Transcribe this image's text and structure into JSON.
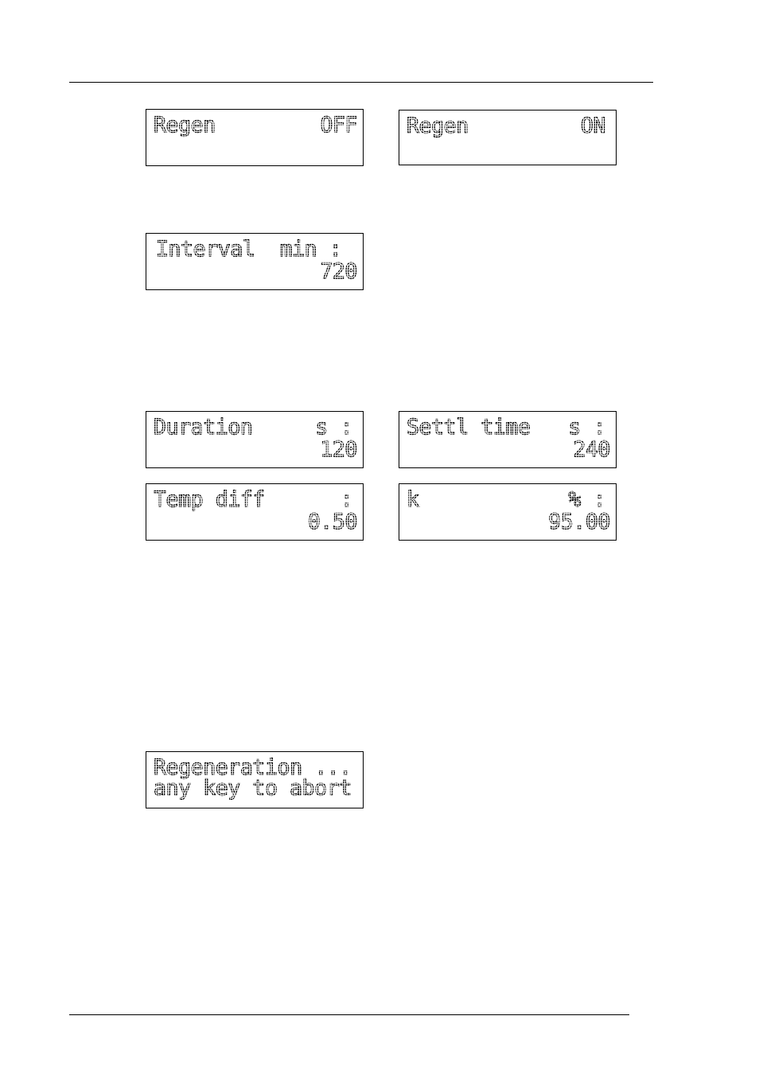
{
  "displays": [
    {
      "id": "regen-off",
      "line1_left": "Regen",
      "line1_right": "OFF",
      "line2_left": "",
      "line2_right": ""
    },
    {
      "id": "regen-on",
      "line1_left": "Regen",
      "line1_right": "ON",
      "line2_left": "",
      "line2_right": ""
    },
    {
      "id": "interval",
      "line1_left": "Interval  min :",
      "line1_right": "",
      "line2_left": "",
      "line2_right": "720"
    },
    {
      "id": "duration",
      "line1_left": "Duration",
      "line1_right": "s :",
      "line2_left": "",
      "line2_right": "120"
    },
    {
      "id": "settl-time",
      "line1_left": "Settl time",
      "line1_right": "s :",
      "line2_left": "",
      "line2_right": "240"
    },
    {
      "id": "temp-diff",
      "line1_left": "Temp diff",
      "line1_right": ":",
      "line2_left": "",
      "line2_right": "0.50"
    },
    {
      "id": "k-percent",
      "line1_left": "k",
      "line1_right": "% :",
      "line2_left": "",
      "line2_right": "95.00"
    },
    {
      "id": "regeneration",
      "line1_left": "Regeneration ...",
      "line1_right": "",
      "line2_left": "any key to abort",
      "line2_right": ""
    }
  ]
}
